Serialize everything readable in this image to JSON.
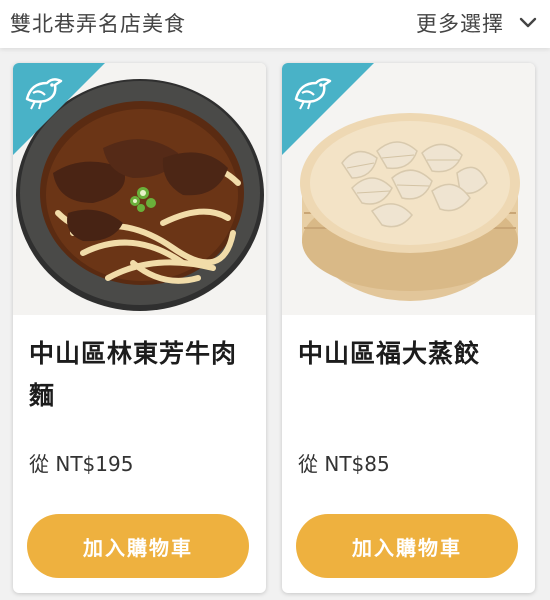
{
  "header": {
    "title": "雙北巷弄名店美食",
    "more_label": "更多選擇"
  },
  "products": [
    {
      "name": "中山區林東芳牛肉麵",
      "price": "從 NT$195",
      "button_label": "加入購物車",
      "image": "beef-noodle-soup-image"
    },
    {
      "name": "中山區福大蒸餃",
      "price": "從 NT$85",
      "button_label": "加入購物車",
      "image": "steamed-dumplings-image"
    }
  ],
  "colors": {
    "accent_button": "#eeb13f",
    "badge": "#49b2c7",
    "background": "#f1f1f1"
  }
}
